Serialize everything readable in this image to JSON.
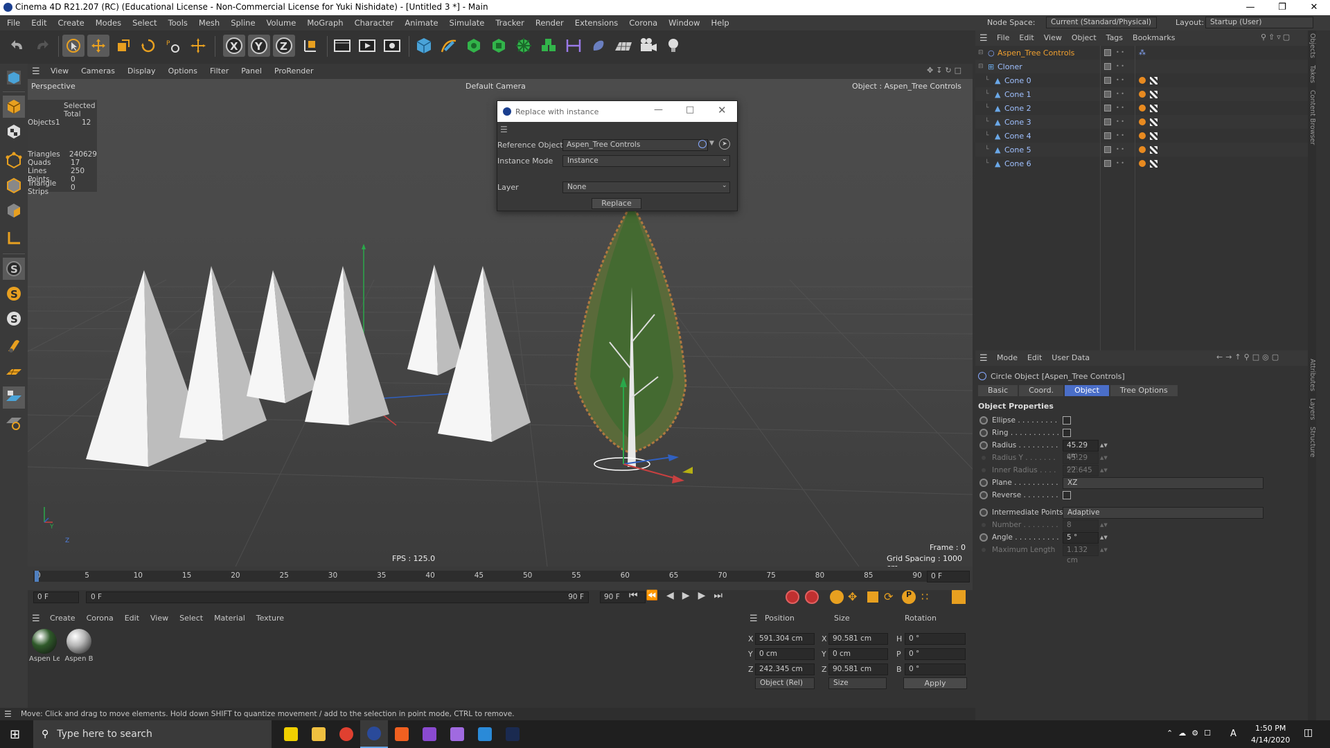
{
  "window": {
    "title": "Cinema 4D R21.207 (RC) (Educational License - Non-Commercial License for Yuki Nishidate) - [Untitled 3 *] - Main"
  },
  "menubar": {
    "items": [
      "File",
      "Edit",
      "Create",
      "Modes",
      "Select",
      "Tools",
      "Mesh",
      "Spline",
      "Volume",
      "MoGraph",
      "Character",
      "Animate",
      "Simulate",
      "Tracker",
      "Render",
      "Extensions",
      "Corona",
      "Window",
      "Help"
    ],
    "node_space_label": "Node Space:",
    "node_space_value": "Current (Standard/Physical)",
    "layout_label": "Layout:",
    "layout_value": "Startup (User)"
  },
  "viewport": {
    "menu": [
      "View",
      "Cameras",
      "Display",
      "Options",
      "Filter",
      "Panel",
      "ProRender"
    ],
    "name": "Perspective",
    "camera": "Default Camera",
    "object_label": "Object : Aspen_Tree Controls",
    "stats_header": "Selected Total",
    "stats": [
      {
        "label": "Objects",
        "sel": "1",
        "total": "12"
      },
      {
        "label": "Triangles",
        "sel": "",
        "total": "240629"
      },
      {
        "label": "Quads",
        "sel": "",
        "total": "17"
      },
      {
        "label": "Lines",
        "sel": "",
        "total": "250"
      },
      {
        "label": "Points",
        "sel": "",
        "total": "0"
      },
      {
        "label": "Triangle Strips",
        "sel": "",
        "total": "0"
      }
    ],
    "fps": "FPS : 125.0",
    "frame": "Frame : 0",
    "grid": "Grid Spacing : 1000 cm",
    "axis_y": "Y",
    "axis_z": "Z"
  },
  "dialog": {
    "title": "Replace with instance",
    "ref_label": "Reference Object",
    "ref_value": "Aspen_Tree Controls",
    "mode_label": "Instance Mode",
    "mode_value": "Instance",
    "layer_label": "Layer",
    "layer_value": "None",
    "button": "Replace"
  },
  "timeline": {
    "ticks": [
      "0",
      "5",
      "10",
      "15",
      "20",
      "25",
      "30",
      "35",
      "40",
      "45",
      "50",
      "55",
      "60",
      "65",
      "70",
      "75",
      "80",
      "85",
      "90"
    ],
    "end_field": "0 F",
    "start": "0 F",
    "range_start": "0 F",
    "range_end": "90 F",
    "max": "90 F"
  },
  "materials": {
    "menu": [
      "Create",
      "Corona",
      "Edit",
      "View",
      "Select",
      "Material",
      "Texture"
    ],
    "items": [
      {
        "name": "Aspen Le",
        "color": "#2f5a2a"
      },
      {
        "name": "Aspen B",
        "color": "#b5b5b5"
      }
    ]
  },
  "coords": {
    "headers": [
      "Position",
      "Size",
      "Rotation"
    ],
    "rows": [
      {
        "axis": "X",
        "pos": "591.304 cm",
        "saxis": "X",
        "size": "90.581 cm",
        "raxis": "H",
        "rot": "0 °"
      },
      {
        "axis": "Y",
        "pos": "0 cm",
        "saxis": "Y",
        "size": "0 cm",
        "raxis": "P",
        "rot": "0 °"
      },
      {
        "axis": "Z",
        "pos": "242.345 cm",
        "saxis": "Z",
        "size": "90.581 cm",
        "raxis": "B",
        "rot": "0 °"
      }
    ],
    "mode": "Object (Rel)",
    "size_mode": "Size",
    "apply": "Apply"
  },
  "status": "Move: Click and drag to move elements. Hold down SHIFT to quantize movement / add to the selection in point mode, CTRL to remove.",
  "objects": {
    "menu": [
      "File",
      "Edit",
      "View",
      "Object",
      "Tags",
      "Bookmarks"
    ],
    "items": [
      {
        "name": "Aspen_Tree Controls",
        "level": 0,
        "selected": true
      },
      {
        "name": "Cloner",
        "level": 0,
        "selected": false
      },
      {
        "name": "Cone 0",
        "level": 1,
        "selected": false
      },
      {
        "name": "Cone 1",
        "level": 1,
        "selected": false
      },
      {
        "name": "Cone 2",
        "level": 1,
        "selected": false
      },
      {
        "name": "Cone 3",
        "level": 1,
        "selected": false
      },
      {
        "name": "Cone 4",
        "level": 1,
        "selected": false
      },
      {
        "name": "Cone 5",
        "level": 1,
        "selected": false
      },
      {
        "name": "Cone 6",
        "level": 1,
        "selected": false
      }
    ],
    "side_tabs": [
      "Objects",
      "Takes",
      "Content Browser"
    ]
  },
  "attributes": {
    "menu": [
      "Mode",
      "Edit",
      "User Data"
    ],
    "object_title": "Circle Object [Aspen_Tree Controls]",
    "tabs": [
      "Basic",
      "Coord.",
      "Object",
      "Tree Options"
    ],
    "active_tab": "Object",
    "section": "Object Properties",
    "props": [
      {
        "label": "Ellipse . . . . . . . . .",
        "type": "check",
        "value": "",
        "enabled": true
      },
      {
        "label": "Ring . . . . . . . . . . .",
        "type": "check",
        "value": "",
        "enabled": true
      },
      {
        "label": "Radius . . . . . . . . .",
        "type": "num",
        "value": "45.29 cm",
        "enabled": true
      },
      {
        "label": "Radius Y . . . . . . .",
        "type": "num",
        "value": "45.29 cm",
        "enabled": false
      },
      {
        "label": "Inner Radius . . . .",
        "type": "num",
        "value": "22.645 cm",
        "enabled": false
      },
      {
        "label": "Plane . . . . . . . . . .",
        "type": "select",
        "value": "XZ",
        "enabled": true
      },
      {
        "label": "Reverse . . . . . . . .",
        "type": "check",
        "value": "",
        "enabled": true
      },
      {
        "label": "Intermediate Points",
        "type": "select",
        "value": "Adaptive",
        "enabled": true
      },
      {
        "label": "Number . . . . . . . .",
        "type": "num",
        "value": "8",
        "enabled": false
      },
      {
        "label": "Angle . . . . . . . . . .",
        "type": "num",
        "value": "5 °",
        "enabled": true
      },
      {
        "label": "Maximum Length",
        "type": "num",
        "value": "1.132 cm",
        "enabled": false
      }
    ],
    "side_tabs": [
      "Attributes",
      "Layers",
      "Structure"
    ]
  },
  "taskbar": {
    "search_placeholder": "Type here to search",
    "time": "1:50 PM",
    "date": "4/14/2020",
    "lang": "A",
    "apps": [
      "sticky-notes",
      "file-explorer",
      "chrome",
      "cinema4d",
      "houdini",
      "visual-studio",
      "visual-studio-2",
      "vscode",
      "photoshop"
    ]
  }
}
